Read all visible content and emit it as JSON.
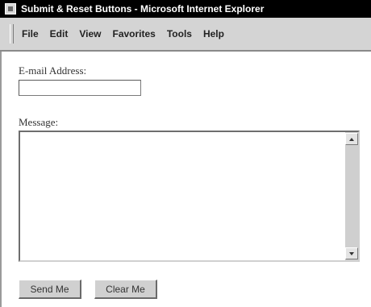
{
  "window": {
    "title": "Submit & Reset Buttons - Microsoft Internet Explorer"
  },
  "menubar": {
    "items": [
      "File",
      "Edit",
      "View",
      "Favorites",
      "Tools",
      "Help"
    ]
  },
  "form": {
    "email_label": "E-mail Address:",
    "email_value": "",
    "message_label": "Message:",
    "message_value": "",
    "submit_label": "Send Me",
    "reset_label": "Clear Me"
  },
  "icons": {
    "app": "browser-window-icon",
    "scroll_up": "scroll-up-arrow-icon",
    "scroll_down": "scroll-down-arrow-icon"
  },
  "colors": {
    "titlebar": "#000000",
    "menubar": "#d4d4d4",
    "button_face": "#d0d0d0"
  }
}
